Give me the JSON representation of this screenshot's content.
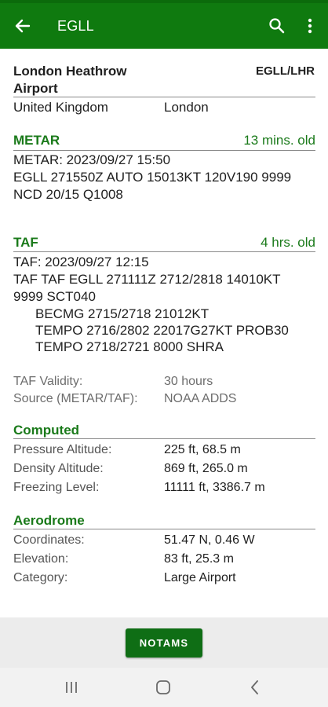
{
  "appbar": {
    "title": "EGLL"
  },
  "airport": {
    "name": "London Heathrow Airport",
    "codes": "EGLL/LHR",
    "country": "United Kingdom",
    "city": "London"
  },
  "metar": {
    "heading": "METAR",
    "age": "13 mins. old",
    "time": "METAR: 2023/09/27 15:50",
    "raw_line1": "EGLL 271550Z AUTO 15013KT 120V190 9999",
    "raw_line2": "NCD 20/15 Q1008"
  },
  "taf": {
    "heading": "TAF",
    "age": "4 hrs. old",
    "time": "TAF: 2023/09/27 12:15",
    "raw_line1": "TAF TAF EGLL 271111Z 2712/2818 14010KT",
    "raw_line2": "9999 SCT040",
    "groups": [
      "BECMG 2715/2718 21012KT",
      "TEMPO 2716/2802 22017G27KT PROB30",
      "TEMPO 2718/2721 8000 SHRA"
    ],
    "validity_label": "TAF Validity:",
    "validity_value": "30 hours",
    "source_label": "Source (METAR/TAF):",
    "source_value": "NOAA ADDS"
  },
  "computed": {
    "heading": "Computed",
    "rows": [
      {
        "label": "Pressure Altitude:",
        "value": "225 ft, 68.5 m"
      },
      {
        "label": "Density Altitude:",
        "value": "869 ft, 265.0 m"
      },
      {
        "label": "Freezing Level:",
        "value": "11111 ft, 3386.7 m"
      }
    ]
  },
  "aerodrome": {
    "heading": "Aerodrome",
    "rows": [
      {
        "label": "Coordinates:",
        "value": "51.47 N, 0.46 W"
      },
      {
        "label": "Elevation:",
        "value": "83 ft, 25.3 m"
      },
      {
        "label": "Category:",
        "value": "Large Airport"
      }
    ]
  },
  "footer": {
    "notams_label": "NOTAMS"
  },
  "colors": {
    "appbar": "#0f7a0f",
    "accent": "#1a7a1a",
    "button": "#0f6e15"
  },
  "icons": {
    "back": "arrow-left-icon",
    "search": "search-icon",
    "more": "more-vertical-icon",
    "nav_recents": "recents-icon",
    "nav_home": "home-icon",
    "nav_back": "nav-back-icon"
  }
}
